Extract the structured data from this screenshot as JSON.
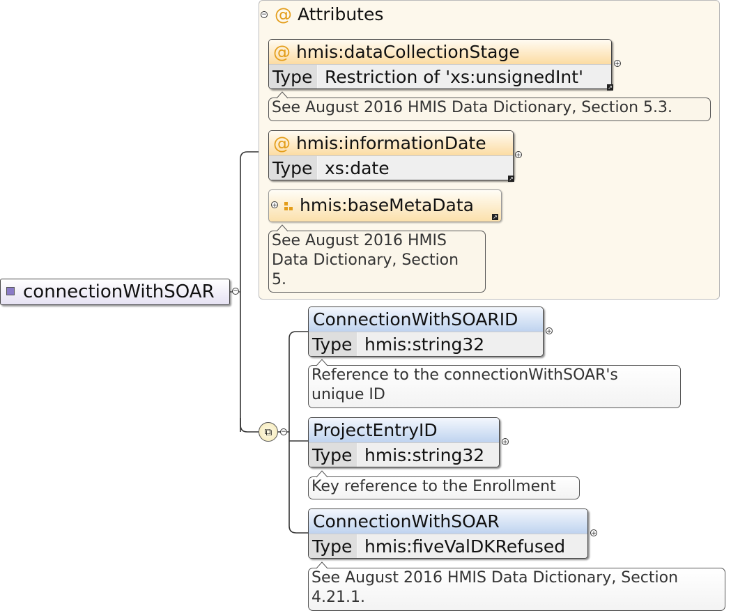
{
  "root": {
    "label": "connectionWithSOAR"
  },
  "attributes_group": {
    "title": "Attributes",
    "at_symbol": "@",
    "items": [
      {
        "name": "hmis:dataCollectionStage",
        "type_label": "Type",
        "type_value": "Restriction of 'xs:unsignedInt'",
        "note": "See August 2016 HMIS Data Dictionary, Section 5.3."
      },
      {
        "name": "hmis:informationDate",
        "type_label": "Type",
        "type_value": "xs:date"
      }
    ],
    "group_ref": {
      "name": "hmis:baseMetaData",
      "note_lines": [
        "See August 2016 HMIS",
        "Data Dictionary, Section",
        "5."
      ]
    }
  },
  "sequence": {
    "icon": "sequence-compositor-icon",
    "elements": [
      {
        "name": "ConnectionWithSOARID",
        "type_label": "Type",
        "type_value": "hmis:string32",
        "note_lines": [
          "Reference to the connectionWithSOAR's",
          "unique ID"
        ]
      },
      {
        "name": "ProjectEntryID",
        "type_label": "Type",
        "type_value": "hmis:string32",
        "note_lines": [
          "Key reference to the Enrollment"
        ]
      },
      {
        "name": "ConnectionWithSOAR",
        "type_label": "Type",
        "type_value": "hmis:fiveValDKRefused",
        "note_lines": [
          "See August 2016 HMIS Data Dictionary, Section",
          "4.21.1."
        ]
      }
    ]
  },
  "colors": {
    "attr_header": "#fcdca3",
    "element_header": "#bfd3ef",
    "attr_group_bg": "#fdf8ec",
    "at_symbol": "#e39d1a"
  }
}
